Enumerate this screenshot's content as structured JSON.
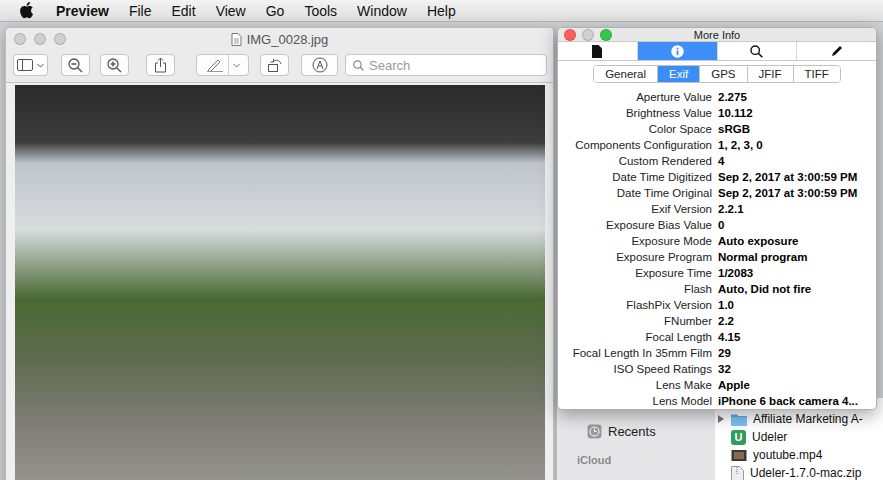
{
  "menu_bar": {
    "app_name": "Preview",
    "items": [
      "File",
      "Edit",
      "View",
      "Go",
      "Tools",
      "Window",
      "Help"
    ]
  },
  "preview_window": {
    "title": "IMG_0028.jpg",
    "active": false,
    "search": {
      "placeholder": "Search"
    }
  },
  "info_panel": {
    "title": "More Info",
    "active": true,
    "minimize_enabled": false,
    "icon_tabs": [
      {
        "kind": "document",
        "selected": false
      },
      {
        "kind": "info",
        "selected": true
      },
      {
        "kind": "search",
        "selected": false
      },
      {
        "kind": "edit",
        "selected": false
      }
    ],
    "segments": [
      {
        "label": "General",
        "selected": false
      },
      {
        "label": "Exif",
        "selected": true
      },
      {
        "label": "GPS",
        "selected": false
      },
      {
        "label": "JFIF",
        "selected": false
      },
      {
        "label": "TIFF",
        "selected": false
      }
    ],
    "rows": [
      {
        "label": "Aperture Value",
        "value": "2.275"
      },
      {
        "label": "Brightness Value",
        "value": "10.112"
      },
      {
        "label": "Color Space",
        "value": "sRGB"
      },
      {
        "label": "Components Configuration",
        "value": "1, 2, 3, 0"
      },
      {
        "label": "Custom Rendered",
        "value": "4"
      },
      {
        "label": "Date Time Digitized",
        "value": "Sep 2, 2017 at 3:00:59 PM"
      },
      {
        "label": "Date Time Original",
        "value": "Sep 2, 2017 at 3:00:59 PM"
      },
      {
        "label": "Exif Version",
        "value": "2.2.1"
      },
      {
        "label": "Exposure Bias Value",
        "value": "0"
      },
      {
        "label": "Exposure Mode",
        "value": "Auto exposure"
      },
      {
        "label": "Exposure Program",
        "value": "Normal program"
      },
      {
        "label": "Exposure Time",
        "value": "1/2083"
      },
      {
        "label": "Flash",
        "value": "Auto, Did not fire"
      },
      {
        "label": "FlashPix Version",
        "value": "1.0"
      },
      {
        "label": "FNumber",
        "value": "2.2"
      },
      {
        "label": "Focal Length",
        "value": "4.15"
      },
      {
        "label": "Focal Length In 35mm Film",
        "value": "29"
      },
      {
        "label": "ISO Speed Ratings",
        "value": "32"
      },
      {
        "label": "Lens Make",
        "value": "Apple"
      },
      {
        "label": "Lens Model",
        "value": "iPhone 6 back camera 4..."
      }
    ]
  },
  "finder": {
    "sidebar": {
      "items": [
        {
          "label": "Recents"
        }
      ],
      "sections": [
        {
          "label": "iCloud"
        }
      ]
    },
    "files": [
      {
        "name": "Affiliate Marketing A-",
        "kind": "folder",
        "expanded": false
      },
      {
        "name": "Udeler",
        "kind": "app",
        "badge": "U"
      },
      {
        "name": "youtube.mp4",
        "kind": "video"
      },
      {
        "name": "Udeler-1.7.0-mac.zip",
        "kind": "zip"
      }
    ]
  }
}
